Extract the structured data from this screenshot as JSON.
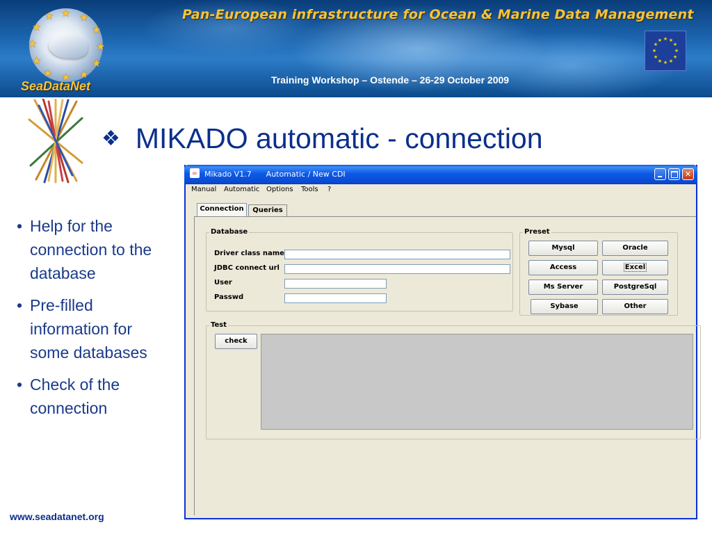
{
  "banner": {
    "title": "Pan-European infrastructure for Ocean & Marine Data Management",
    "subtitle": "Training Workshop – Ostende – 26-29 October 2009",
    "logo_text": "SeaDataNet",
    "logo_icon": "seadatanet-logo",
    "flag_icon": "eu-flag"
  },
  "slide": {
    "title": "MIKADO automatic - connection",
    "title_bullet": "❖",
    "bullets": [
      "Help for the connection to the database",
      "Pre-filled information for some databases",
      "Check of the connection"
    ],
    "footer_url": "www.seadatanet.org"
  },
  "window": {
    "title": "Mikado V1.7      Automatic / New CDI",
    "controls": {
      "minimize": "minimize-icon",
      "maximize": "maximize-icon",
      "close": "close-icon"
    },
    "menu": [
      "Manual",
      "Automatic",
      "Options",
      "Tools",
      "?"
    ],
    "tabs": [
      {
        "label": "Connection",
        "active": true
      },
      {
        "label": "Queries",
        "active": false
      }
    ],
    "database": {
      "title": "Database",
      "fields": [
        {
          "label": "Driver class name",
          "value": ""
        },
        {
          "label": "JDBC connect url",
          "value": ""
        },
        {
          "label": "User",
          "value": ""
        },
        {
          "label": "Passwd",
          "value": ""
        }
      ]
    },
    "preset": {
      "title": "Preset",
      "buttons": [
        "Mysql",
        "Oracle",
        "Access",
        "Excel",
        "Ms Server",
        "PostgreSql",
        "Sybase",
        "Other"
      ]
    },
    "test": {
      "title": "Test",
      "check_label": "check",
      "output": ""
    }
  },
  "colors": {
    "title_blue": "#0b2f8c",
    "banner_gold": "#f5c33c",
    "xp_blue": "#0a5adf"
  }
}
